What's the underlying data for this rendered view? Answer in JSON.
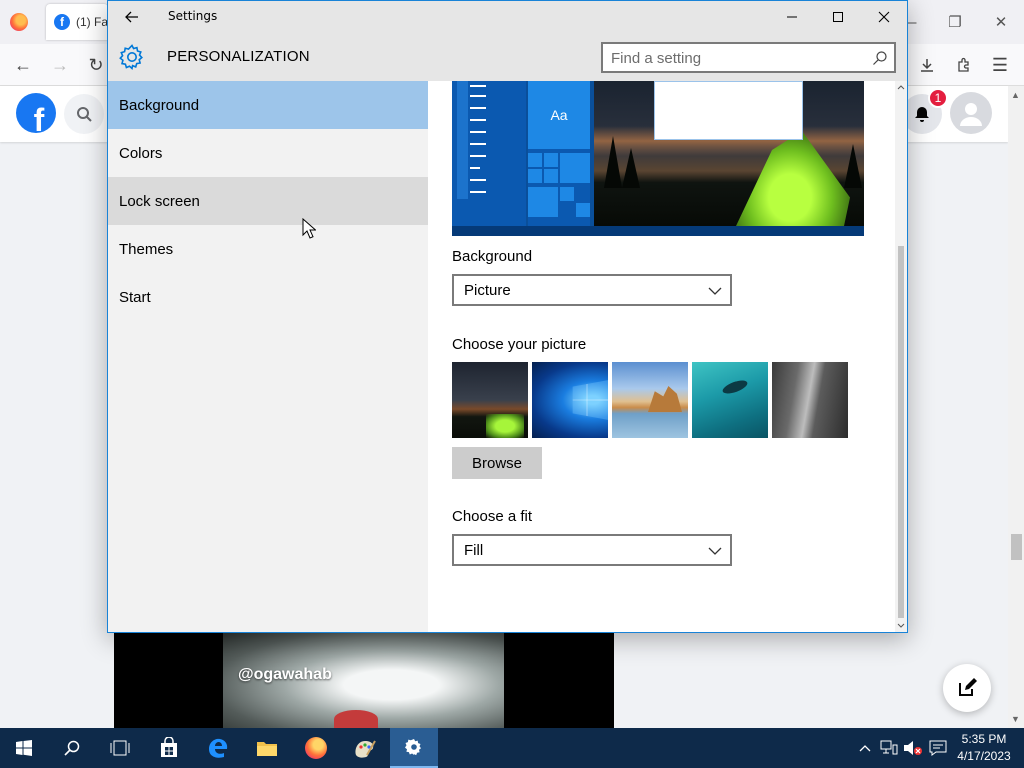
{
  "browser": {
    "tab_title": "(1) Fa",
    "facebook_logo": "f",
    "notifications_count": "1"
  },
  "video": {
    "handle": "@ogawahab"
  },
  "settings": {
    "window_title": "Settings",
    "header_title": "PERSONALIZATION",
    "search": {
      "placeholder": "Find a setting",
      "value": ""
    },
    "nav": {
      "items": [
        {
          "label": "Background",
          "state": "selected"
        },
        {
          "label": "Colors",
          "state": "normal"
        },
        {
          "label": "Lock screen",
          "state": "hover"
        },
        {
          "label": "Themes",
          "state": "normal"
        },
        {
          "label": "Start",
          "state": "normal"
        }
      ]
    },
    "preview": {
      "tile_text": "Aa"
    },
    "background": {
      "label": "Background",
      "value": "Picture"
    },
    "choose_picture": {
      "label": "Choose your picture",
      "browse_label": "Browse"
    },
    "fit": {
      "label": "Choose a fit",
      "value": "Fill"
    }
  },
  "taskbar": {
    "time": "5:35 PM",
    "date": "4/17/2023"
  },
  "colors": {
    "accent": "#0078d7",
    "nav_selected": "#9dc5ea",
    "taskbar": "#0e2a4a",
    "facebook": "#1877f2"
  }
}
